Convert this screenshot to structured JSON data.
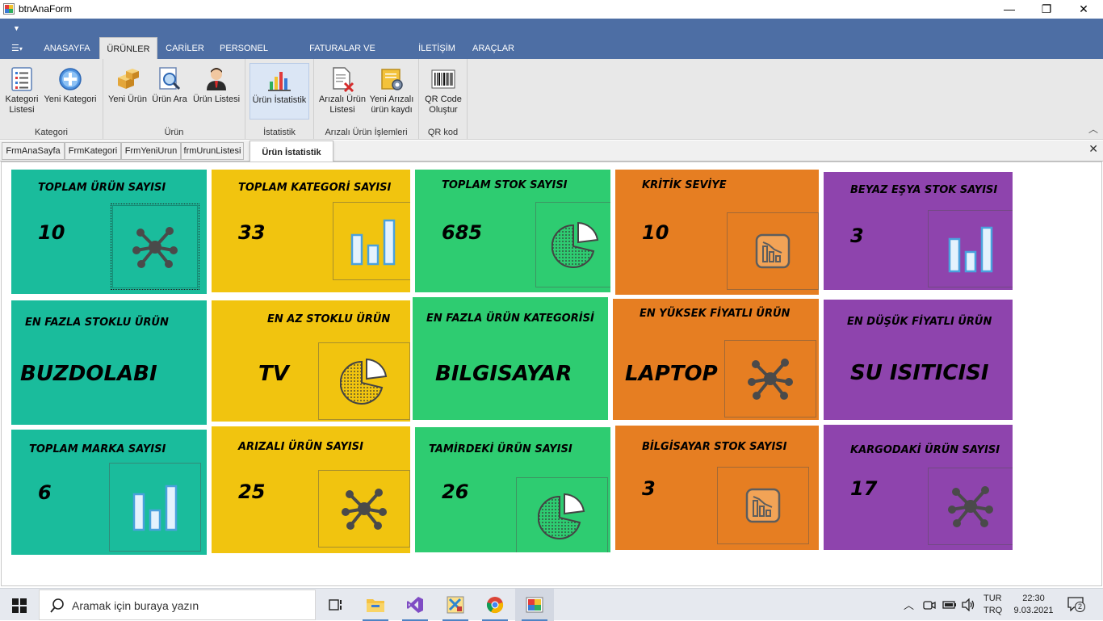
{
  "window": {
    "title": "btnAnaForm",
    "minimize": "—",
    "restore": "❐",
    "close": "✕"
  },
  "ribbon": {
    "menu_glyph": "☰",
    "tabs": [
      {
        "label": "ANASAYFA"
      },
      {
        "label": "ÜRÜNLER"
      },
      {
        "label": "CARİLER"
      },
      {
        "label": "PERSONEL"
      },
      {
        "label": "FATURALAR VE HAREKETLER"
      },
      {
        "label": "İLETİŞİM"
      },
      {
        "label": "ARAÇLAR"
      }
    ],
    "active_tab": "ÜRÜNLER",
    "groups": {
      "kategori": {
        "label": "Kategori",
        "buttons": [
          {
            "label": "Kategori\nListesi",
            "icon": "list-icon"
          },
          {
            "label": "Yeni Kategori",
            "icon": "plus-icon"
          }
        ]
      },
      "urun": {
        "label": "Ürün",
        "buttons": [
          {
            "label": "Yeni Ürün",
            "icon": "boxes-icon"
          },
          {
            "label": "Ürün Ara",
            "icon": "search-doc-icon"
          },
          {
            "label": "Ürün Listesi",
            "icon": "person-icon"
          }
        ]
      },
      "istatistik": {
        "label": "İstatistik",
        "buttons": [
          {
            "label": "Ürün İstatistik",
            "icon": "bar-chart-icon"
          }
        ]
      },
      "arizali": {
        "label": "Arızalı Ürün İşlemleri",
        "buttons": [
          {
            "label": "Arızalı Ürün\nListesi",
            "icon": "doc-delete-icon"
          },
          {
            "label": "Yeni Arızalı\nürün kaydı",
            "icon": "doc-gear-icon"
          }
        ]
      },
      "qr": {
        "label": "QR kod",
        "buttons": [
          {
            "label": "QR Code\nOluştur",
            "icon": "barcode-icon"
          }
        ]
      }
    }
  },
  "doc_tabs": [
    {
      "label": "FrmAnaSayfa"
    },
    {
      "label": "FrmKategori"
    },
    {
      "label": "FrmYeniUrun"
    },
    {
      "label": "frmUrunListesi"
    },
    {
      "label": "Ürün İstatistik"
    }
  ],
  "colors": {
    "teal": "#1abc9c",
    "yellow": "#f1c40f",
    "green": "#2ecc71",
    "orange": "#e67e22",
    "purple": "#8e44ad"
  },
  "tiles": [
    {
      "title": "TOPLAM ÜRÜN SAYISI",
      "value": "10",
      "icon": "network-icon",
      "color": "teal"
    },
    {
      "title": "TOPLAM KATEGORİ SAYISI",
      "value": "33",
      "icon": "bar-chart-icon",
      "color": "yellow"
    },
    {
      "title": "TOPLAM STOK SAYISI",
      "value": "685",
      "icon": "pie-chart-icon",
      "color": "green"
    },
    {
      "title": "KRİTİK SEVİYE",
      "value": "10",
      "icon": "report-icon",
      "color": "orange"
    },
    {
      "title": "BEYAZ EŞYA STOK SAYISI",
      "value": "3",
      "icon": "bar-chart-icon",
      "color": "purple"
    },
    {
      "title": "EN FAZLA STOKLU ÜRÜN",
      "value": "BUZDOLABI",
      "icon": "",
      "color": "teal"
    },
    {
      "title": "EN AZ STOKLU ÜRÜN",
      "value": "TV",
      "icon": "pie-chart-icon",
      "color": "yellow"
    },
    {
      "title": "EN FAZLA ÜRÜN KATEGORİSİ",
      "value": "BILGISAYAR",
      "icon": "",
      "color": "green"
    },
    {
      "title": "EN YÜKSEK FİYATLI ÜRÜN",
      "value": "LAPTOP",
      "icon": "network-icon",
      "color": "orange"
    },
    {
      "title": "EN DÜŞÜK FİYATLI ÜRÜN",
      "value": "SU ISITICISI",
      "icon": "",
      "color": "purple"
    },
    {
      "title": "TOPLAM MARKA SAYISI",
      "value": "6",
      "icon": "bar-chart-icon",
      "color": "teal"
    },
    {
      "title": "ARIZALI ÜRÜN SAYISI",
      "value": "25",
      "icon": "network-icon",
      "color": "yellow"
    },
    {
      "title": "TAMİRDEKİ ÜRÜN SAYISI",
      "value": "26",
      "icon": "pie-chart-icon",
      "color": "green"
    },
    {
      "title": "BİLGİSAYAR STOK SAYISI",
      "value": "3",
      "icon": "report-icon",
      "color": "orange"
    },
    {
      "title": "KARGODAKİ ÜRÜN SAYISI",
      "value": "17",
      "icon": "network-icon",
      "color": "purple"
    }
  ],
  "taskbar": {
    "search_placeholder": "Aramak için buraya yazın",
    "apps": [
      "task-view-icon",
      "file-explorer-icon",
      "visual-studio-icon",
      "sql-tool-icon",
      "chrome-icon",
      "winforms-app-icon"
    ],
    "language": "TUR",
    "keyboard": "TRQ",
    "time": "22:30",
    "date": "9.03.2021",
    "notifications": "2"
  }
}
